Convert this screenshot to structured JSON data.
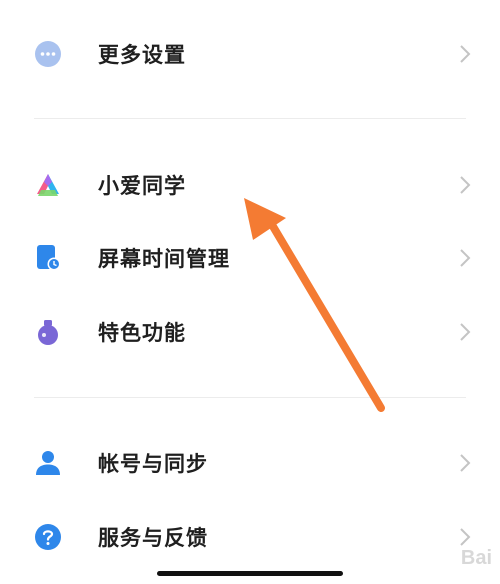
{
  "settings": {
    "items": [
      {
        "label": "更多设置",
        "icon": "more-dots-icon"
      },
      {
        "label": "小爱同学",
        "icon": "xiaoai-icon"
      },
      {
        "label": "屏幕时间管理",
        "icon": "screen-time-icon"
      },
      {
        "label": "特色功能",
        "icon": "flask-icon"
      },
      {
        "label": "帐号与同步",
        "icon": "account-icon"
      },
      {
        "label": "服务与反馈",
        "icon": "help-icon"
      }
    ]
  },
  "watermark": {
    "text": "Bai"
  },
  "colors": {
    "arrow": "#f47b33",
    "blue": "#2e87ea",
    "purple": "#7a67d6",
    "divider": "#ececec",
    "chevron": "#c4c4c4"
  }
}
